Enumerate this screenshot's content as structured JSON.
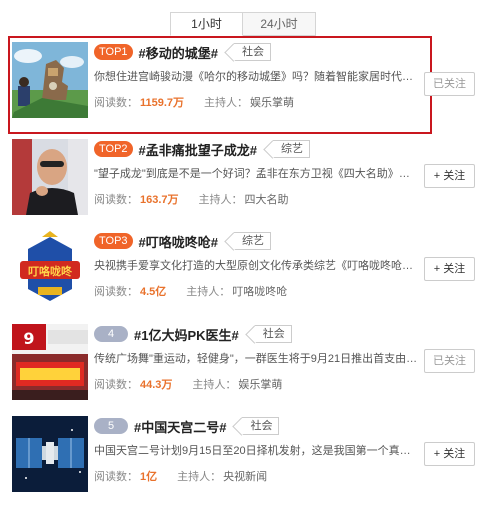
{
  "tabs": [
    {
      "label": "1小时",
      "active": true
    },
    {
      "label": "24小时",
      "active": false
    }
  ],
  "labels": {
    "read_prefix": "阅读数：",
    "host_prefix": "主持人："
  },
  "items": [
    {
      "rank": "TOP1",
      "title": "#移动的城堡#",
      "tag": "社会",
      "desc": "你想住进宫崎骏动漫《哈尔的移动城堡》吗？随着智能家居时代的到来，...",
      "reads": "1159.7万",
      "host": "娱乐掌萌",
      "follow": "已关注",
      "followed": true,
      "highlighted": true
    },
    {
      "rank": "TOP2",
      "title": "#孟非痛批望子成龙#",
      "tag": "综艺",
      "desc": "\"望子成龙\"到底是不是一个好词？孟非在东方卫视《四大名助》节目...",
      "reads": "163.7万",
      "host": "四大名助",
      "follow": "+ 关注",
      "followed": false
    },
    {
      "rank": "TOP3",
      "title": "#叮咯咙咚呛#",
      "tag": "综艺",
      "desc": "央视携手爱享文化打造的大型原创文化传承类综艺《叮咯咙咚呛》第二季...",
      "reads": "4.5亿",
      "host": "叮咯咙咚呛",
      "follow": "+ 关注",
      "followed": false
    },
    {
      "rank": "4",
      "title": "#1亿大妈PK医生#",
      "tag": "社会",
      "desc": "传统广场舞\"重运动，轻健身\"，一群医生将于9月21日推出首支由专业医生...",
      "reads": "44.3万",
      "host": "娱乐掌萌",
      "follow": "已关注",
      "followed": true
    },
    {
      "rank": "5",
      "title": "#中国天宫二号#",
      "tag": "社会",
      "desc": "中国天宫二号计划9月15日至20日择机发射，这是我国第一个真正意义上的...",
      "reads": "1亿",
      "host": "央视新闻",
      "follow": "+ 关注",
      "followed": false
    }
  ],
  "colors": {
    "highlight_border": "#c9171e",
    "rank_top": "#f06429",
    "rank_normal": "#a9b1c6",
    "reads": "#e9722c"
  }
}
